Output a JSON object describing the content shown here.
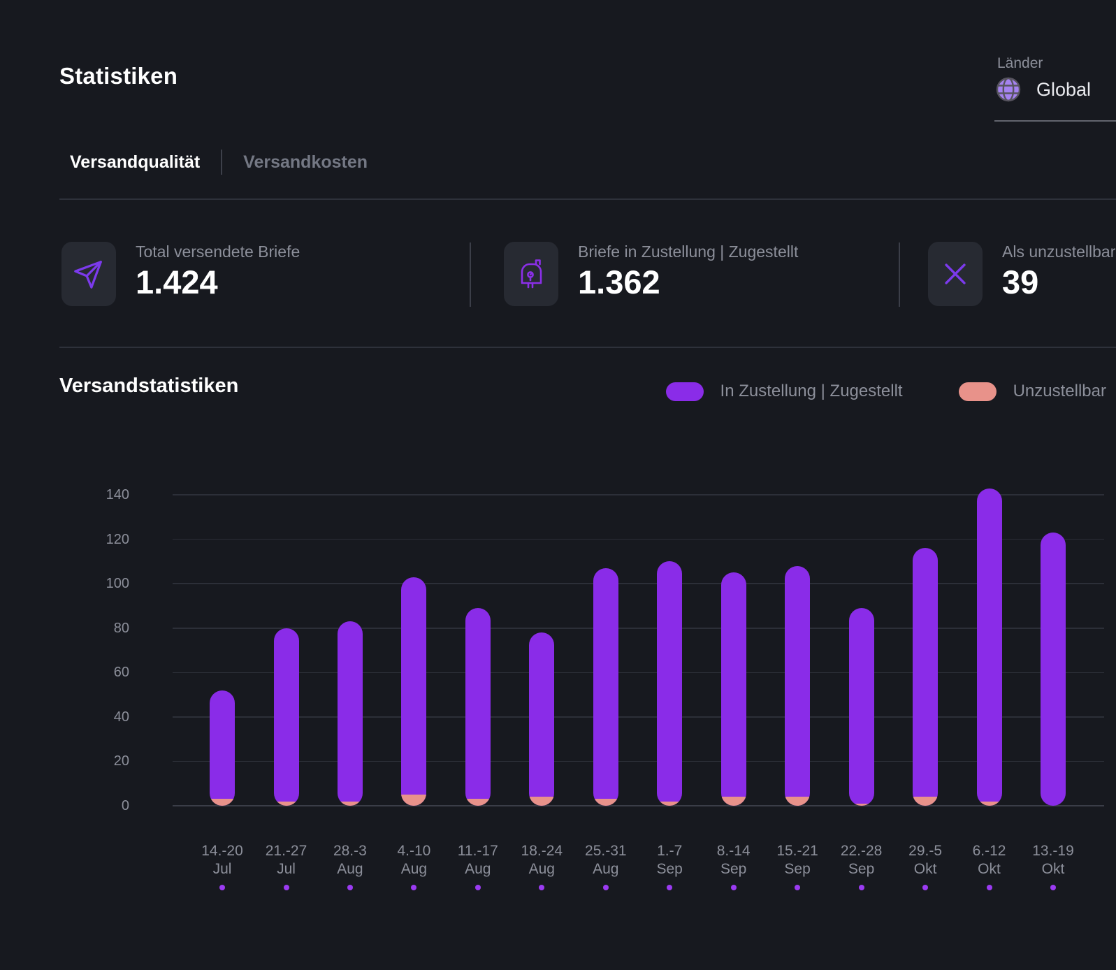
{
  "header": {
    "title": "Statistiken"
  },
  "country_selector": {
    "label": "Länder",
    "value": "Global",
    "icon": "globe-icon"
  },
  "tabs": {
    "items": [
      {
        "label": "Versandqualität"
      },
      {
        "label": "Versandkosten"
      }
    ],
    "active_index": 0
  },
  "stat_cards": [
    {
      "icon": "send-icon",
      "label": "Total versendete Briefe",
      "value": "1.424"
    },
    {
      "icon": "mailbox-icon",
      "label": "Briefe in Zustellung | Zugestellt",
      "value": "1.362"
    },
    {
      "icon": "cross-icon",
      "label": "Als unzustellbar",
      "value": "39"
    }
  ],
  "chart_section": {
    "title": "Versandstatistiken",
    "legend": [
      {
        "label": "In Zustellung | Zugestellt",
        "color": "#8a2ce8"
      },
      {
        "label": "Unzustellbar",
        "color": "#e8928a"
      }
    ]
  },
  "chart_data": {
    "type": "bar",
    "stacked": true,
    "title": "Versandstatistiken",
    "categories": [
      "14.-20 Jul",
      "21.-27 Jul",
      "28.-3 Aug",
      "4.-10 Aug",
      "11.-17 Aug",
      "18.-24 Aug",
      "25.-31 Aug",
      "1.-7 Sep",
      "8.-14 Sep",
      "15.-21 Sep",
      "22.-28 Sep",
      "29.-5 Okt",
      "6.-12 Okt",
      "13.-19 Okt"
    ],
    "series": [
      {
        "name": "In Zustellung | Zugestellt",
        "color": "#8a2ce8",
        "values": [
          49,
          78,
          81,
          98,
          86,
          74,
          104,
          108,
          101,
          104,
          88,
          112,
          141,
          123
        ]
      },
      {
        "name": "Unzustellbar",
        "color": "#e8928a",
        "values": [
          3,
          2,
          2,
          5,
          3,
          4,
          3,
          2,
          4,
          4,
          1,
          4,
          2,
          0
        ]
      }
    ],
    "totals": [
      52,
      80,
      83,
      103,
      89,
      78,
      107,
      110,
      105,
      108,
      89,
      116,
      143,
      123
    ],
    "xlabel": "",
    "ylabel": "",
    "ylim": [
      0,
      140
    ],
    "yticks": [
      0,
      20,
      40,
      60,
      80,
      100,
      120,
      140
    ],
    "grid": true,
    "legend_position": "top-right",
    "x_marker_color": "#9b3bf2"
  }
}
